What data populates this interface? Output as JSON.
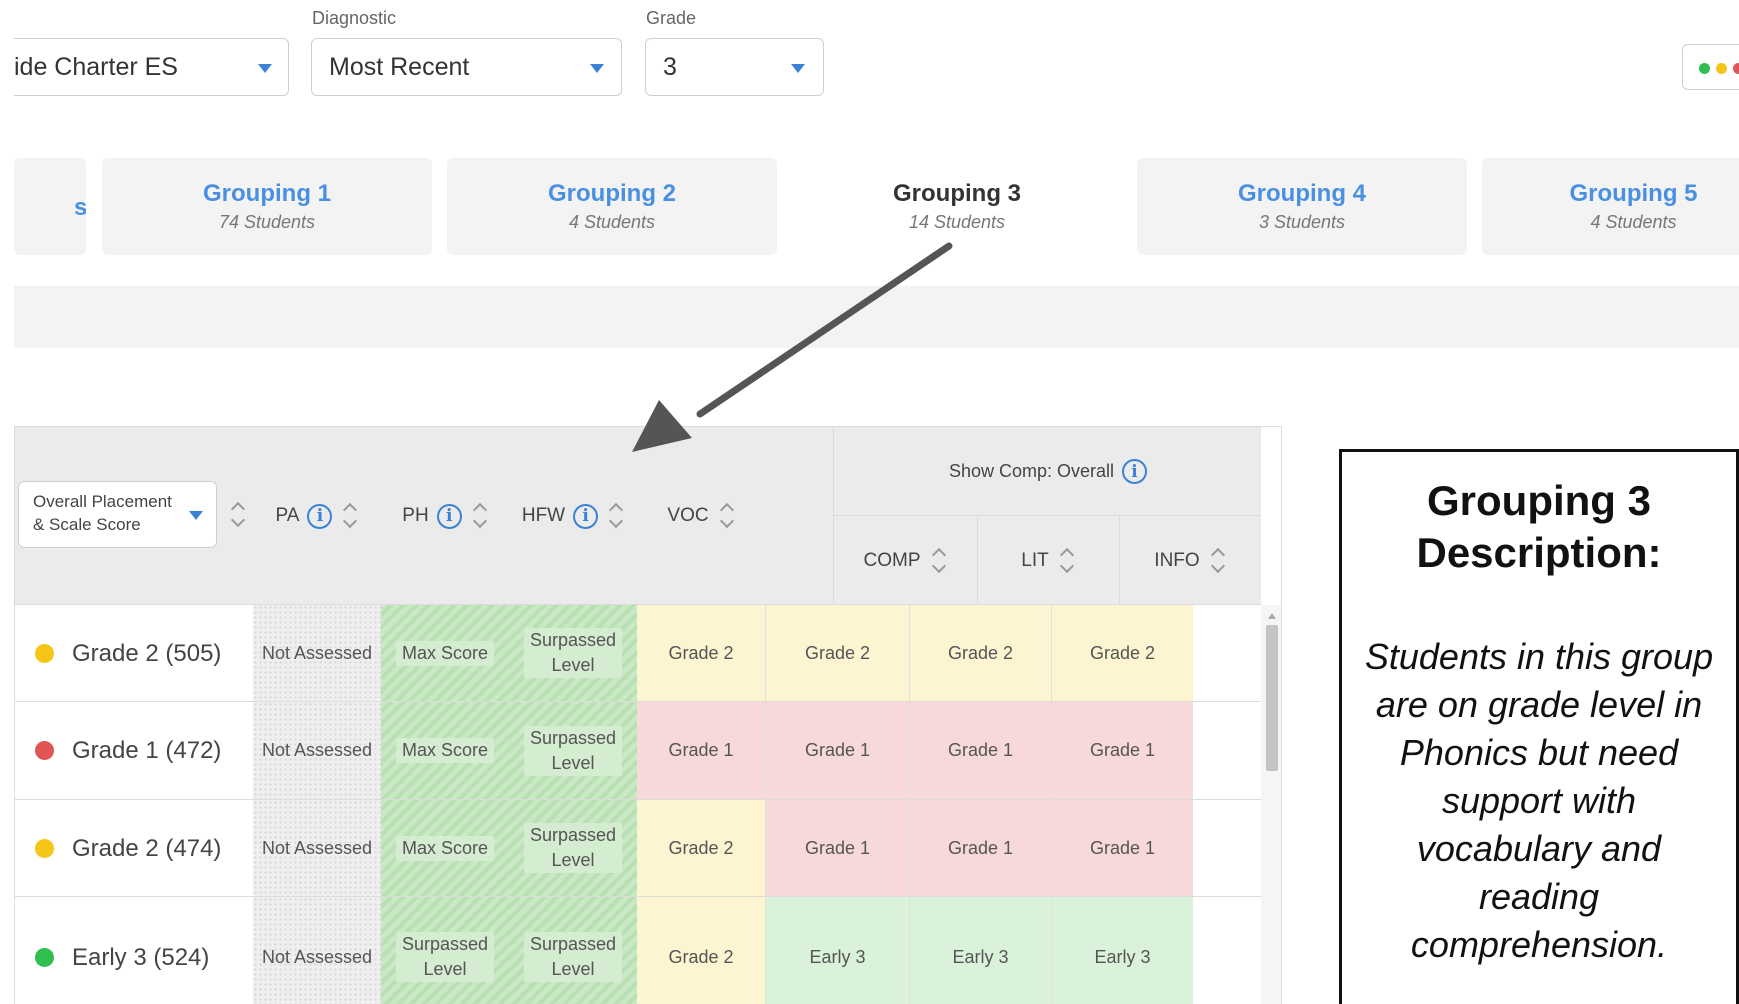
{
  "filters": {
    "school": {
      "value": "ide Charter ES"
    },
    "diagnostic": {
      "label": "Diagnostic",
      "value": "Most Recent"
    },
    "grade": {
      "label": "Grade",
      "value": "3"
    }
  },
  "colors": {
    "accent": "#3b82d6",
    "tab_link": "#4a90e2",
    "dot_yellow": "#f5c518",
    "dot_red": "#e25555",
    "dot_green": "#2fbf4f",
    "cell_yellow": "#fdf4d1",
    "cell_red": "#f7d9d9",
    "cell_green": "#d9f2d9"
  },
  "tabs": {
    "partial_label": "s",
    "items": [
      {
        "title": "Grouping 1",
        "subtitle": "74 Students"
      },
      {
        "title": "Grouping 2",
        "subtitle": "4 Students"
      },
      {
        "title": "Grouping 3",
        "subtitle": "14 Students"
      },
      {
        "title": "Grouping 4",
        "subtitle": "3 Students"
      },
      {
        "title": "Grouping 5",
        "subtitle": "4 Students"
      }
    ],
    "active_index": 2
  },
  "table": {
    "placement_select": {
      "line1": "Overall Placement",
      "line2": "& Scale Score"
    },
    "columns": {
      "pa": "PA",
      "ph": "PH",
      "hfw": "HFW",
      "voc": "VOC",
      "comp_group": "Show Comp: Overall",
      "comp": "COMP",
      "lit": "LIT",
      "info": "INFO"
    },
    "info_glyph": "i",
    "rows": [
      {
        "placement": "Grade 2 (505)",
        "dot": "yellow",
        "pa": "Not Assessed",
        "ph": [
          "Max Score"
        ],
        "hfw": [
          "Surpassed",
          "Level"
        ],
        "voc": "Grade 2",
        "voc_color": "yellow",
        "comp": "Grade 2",
        "comp_color": "yellow",
        "lit": "Grade 2",
        "lit_color": "yellow",
        "info": "Grade 2",
        "info_color": "yellow"
      },
      {
        "placement": "Grade 1 (472)",
        "dot": "red",
        "pa": "Not Assessed",
        "ph": [
          "Max Score"
        ],
        "hfw": [
          "Surpassed",
          "Level"
        ],
        "voc": "Grade 1",
        "voc_color": "red",
        "comp": "Grade 1",
        "comp_color": "red",
        "lit": "Grade 1",
        "lit_color": "red",
        "info": "Grade 1",
        "info_color": "red"
      },
      {
        "placement": "Grade 2 (474)",
        "dot": "yellow",
        "pa": "Not Assessed",
        "ph": [
          "Max Score"
        ],
        "hfw": [
          "Surpassed",
          "Level"
        ],
        "voc": "Grade 2",
        "voc_color": "yellow",
        "comp": "Grade 1",
        "comp_color": "red",
        "lit": "Grade 1",
        "lit_color": "red",
        "info": "Grade 1",
        "info_color": "red"
      },
      {
        "placement": "Early 3 (524)",
        "dot": "green",
        "pa": "Not Assessed",
        "ph": [
          "Surpassed",
          "Level"
        ],
        "hfw": [
          "Surpassed",
          "Level"
        ],
        "voc": "Grade 2",
        "voc_color": "yellow",
        "comp": "Early 3",
        "comp_color": "green",
        "lit": "Early 3",
        "lit_color": "green",
        "info": "Early 3",
        "info_color": "green"
      }
    ]
  },
  "description": {
    "title_line1": "Grouping 3",
    "title_line2": "Description:",
    "body": "Students in this group are on grade level in Phonics but need support with vocabulary and reading comprehension."
  }
}
